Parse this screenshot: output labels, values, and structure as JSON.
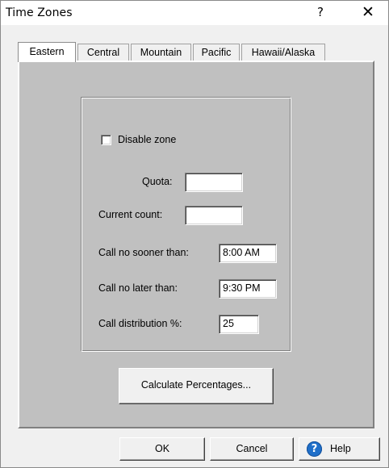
{
  "window": {
    "title": "Time Zones",
    "help_glyph": "?",
    "close_glyph": "✕"
  },
  "tabs": [
    {
      "label": "Eastern",
      "active": true
    },
    {
      "label": "Central",
      "active": false
    },
    {
      "label": "Mountain",
      "active": false
    },
    {
      "label": "Pacific",
      "active": false
    },
    {
      "label": "Hawaii/Alaska",
      "active": false
    }
  ],
  "form": {
    "disable_zone": {
      "label": "Disable zone",
      "checked": false
    },
    "quota": {
      "label": "Quota:",
      "value": ""
    },
    "current_count": {
      "label": "Current count:",
      "value": ""
    },
    "call_no_sooner": {
      "label": "Call no sooner than:",
      "value": "8:00 AM"
    },
    "call_no_later": {
      "label": "Call no later than:",
      "value": "9:30 PM"
    },
    "call_distribution": {
      "label": "Call distribution %:",
      "value": "25"
    }
  },
  "calculate_button": "Calculate Percentages...",
  "buttons": {
    "ok": "OK",
    "cancel": "Cancel",
    "help": "Help"
  },
  "colors": {
    "panel": "#c0c0c0",
    "dialog": "#f0f0f0",
    "help_icon": "#1f6fc9"
  }
}
